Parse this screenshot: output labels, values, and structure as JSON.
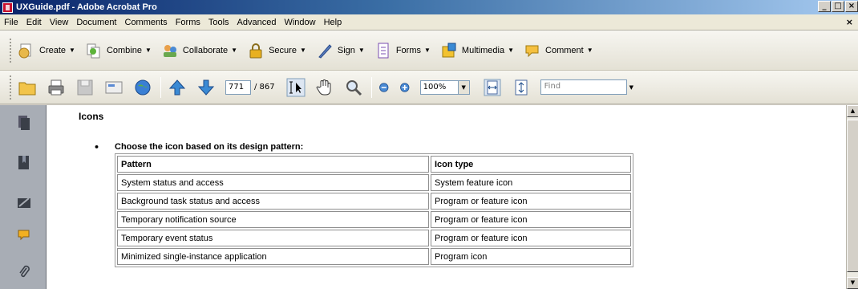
{
  "window": {
    "title": "UXGuide.pdf - Adobe Acrobat Pro",
    "minimize": "_",
    "maximize": "□",
    "close": "×"
  },
  "menu": {
    "items": [
      "File",
      "Edit",
      "View",
      "Document",
      "Comments",
      "Forms",
      "Tools",
      "Advanced",
      "Window",
      "Help"
    ],
    "close_doc": "×"
  },
  "tasks": {
    "items": [
      {
        "label": "Create",
        "icon": "create-icon"
      },
      {
        "label": "Combine",
        "icon": "combine-icon"
      },
      {
        "label": "Collaborate",
        "icon": "collaborate-icon"
      },
      {
        "label": "Secure",
        "icon": "lock-icon"
      },
      {
        "label": "Sign",
        "icon": "pen-icon"
      },
      {
        "label": "Forms",
        "icon": "forms-icon"
      },
      {
        "label": "Multimedia",
        "icon": "multimedia-icon"
      },
      {
        "label": "Comment",
        "icon": "comment-icon"
      }
    ],
    "dropdown_glyph": "▼"
  },
  "nav": {
    "current_page": "771",
    "total_pages": "/ 867",
    "zoom": "100%",
    "find_placeholder": "Find",
    "dropdown_glyph": "▼"
  },
  "document": {
    "heading": "Icons",
    "bullet_marker": "•",
    "bullet_text": "Choose the icon based on its design pattern:",
    "table": {
      "headers": [
        "Pattern",
        "Icon type"
      ],
      "rows": [
        [
          "System status and access",
          "System feature icon"
        ],
        [
          "Background task status and access",
          "Program or feature icon"
        ],
        [
          "Temporary notification source",
          "Program or feature icon"
        ],
        [
          "Temporary event status",
          "Program or feature icon"
        ],
        [
          "Minimized single-instance application",
          "Program icon"
        ]
      ]
    }
  },
  "colors": {
    "title_bar": "#0a246a",
    "left_panel": "#a8adb5",
    "toolbar_bg": "#ece9d8"
  }
}
